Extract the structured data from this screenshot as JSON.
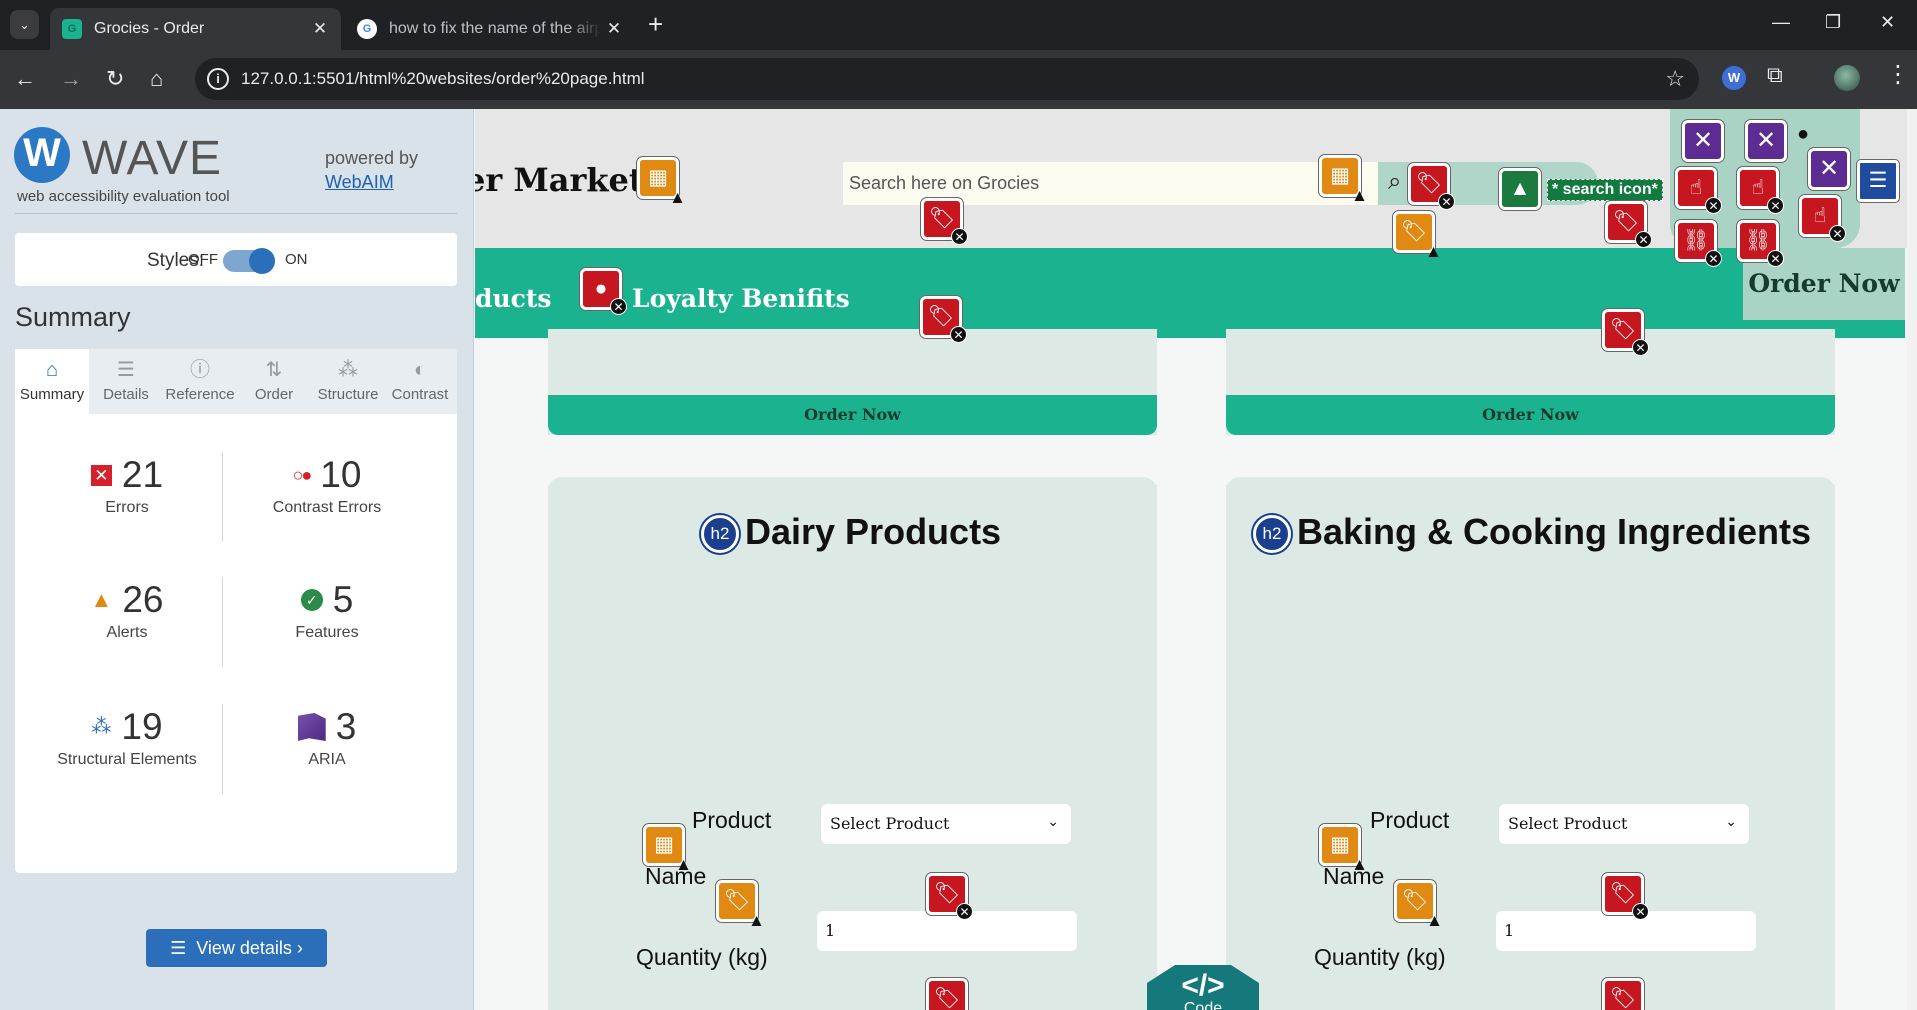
{
  "browser": {
    "tabs": [
      {
        "title": "Grocies - Order",
        "active": true
      },
      {
        "title": "how to fix the name of the airp",
        "active": false
      }
    ],
    "url": "127.0.0.1:5501/html%20websites/order%20page.html"
  },
  "wave": {
    "logo_letter": "W",
    "title": "WAVE",
    "subtitle": "web accessibility evaluation tool",
    "powered_by": "powered by",
    "powered_link": "WebAIM",
    "styles_label": "Styles:",
    "styles_off": "OFF",
    "styles_on": "ON",
    "summary_heading": "Summary",
    "tabs": [
      {
        "label": "Summary",
        "icon": "home-icon"
      },
      {
        "label": "Details",
        "icon": "list-icon"
      },
      {
        "label": "Reference",
        "icon": "info-icon"
      },
      {
        "label": "Order",
        "icon": "order-icon"
      },
      {
        "label": "Structure",
        "icon": "structure-icon"
      },
      {
        "label": "Contrast",
        "icon": "contrast-icon"
      }
    ],
    "stats": {
      "errors": {
        "value": "21",
        "label": "Errors"
      },
      "contrast": {
        "value": "10",
        "label": "Contrast Errors"
      },
      "alerts": {
        "value": "26",
        "label": "Alerts"
      },
      "features": {
        "value": "5",
        "label": "Features"
      },
      "structural": {
        "value": "19",
        "label": "Structural Elements"
      },
      "aria": {
        "value": "3",
        "label": "ARIA"
      }
    },
    "view_details": "View details ›"
  },
  "site": {
    "brand_partial": "er Market",
    "search_placeholder": "Search here on Grocies",
    "search_alt": "* search icon*",
    "nav": {
      "products_partial": "ducts",
      "loyalty": "Loyalty Benifits",
      "order_now": "Order Now"
    },
    "cards": [
      {
        "title": "Dairy Products",
        "order_label": "Order Now"
      },
      {
        "title": "Baking & Cooking Ingredients",
        "order_label": "Order Now"
      }
    ],
    "form": {
      "product_label": "Product",
      "name_label": "Name",
      "quantity_label": "Quantity (kg)",
      "select_value": "Select Product",
      "quantity_value": "1"
    },
    "h2_badge": "h2",
    "code_badge": {
      "glyph": "</>",
      "label": "Code"
    }
  },
  "colors": {
    "accent": "#1bb38f",
    "wave_blue": "#2b6fba",
    "wave_error": "#c6161f",
    "wave_alert": "#e08a13"
  }
}
